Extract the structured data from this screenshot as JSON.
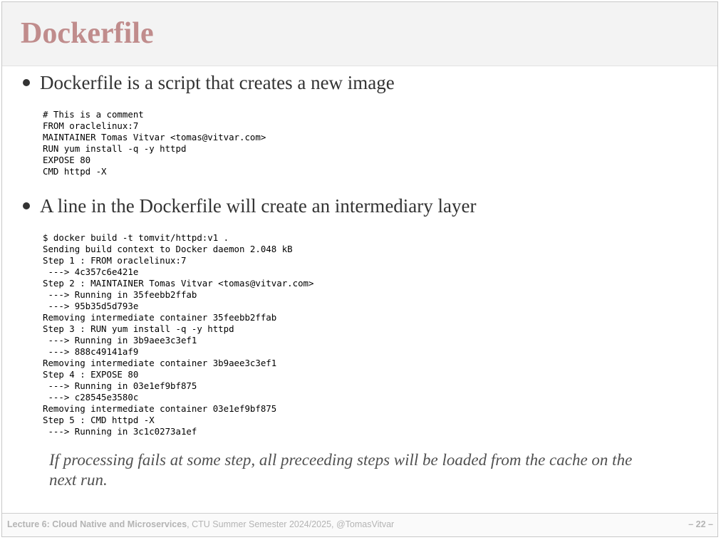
{
  "slide": {
    "title": "Dockerfile",
    "bullets": [
      {
        "text": "Dockerfile is a script that creates a new image",
        "code": "# This is a comment\nFROM oraclelinux:7\nMAINTAINER Tomas Vitvar <tomas@vitvar.com>\nRUN yum install -q -y httpd\nEXPOSE 80\nCMD httpd -X"
      },
      {
        "text": "A line in the Dockerfile will create an intermediary layer",
        "code": "$ docker build -t tomvit/httpd:v1 .\nSending build context to Docker daemon 2.048 kB\nStep 1 : FROM oraclelinux:7\n ---> 4c357c6e421e\nStep 2 : MAINTAINER Tomas Vitvar <tomas@vitvar.com>\n ---> Running in 35feebb2ffab\n ---> 95b35d5d793e\nRemoving intermediate container 35feebb2ffab\nStep 3 : RUN yum install -q -y httpd\n ---> Running in 3b9aee3c3ef1\n ---> 888c49141af9\nRemoving intermediate container 3b9aee3c3ef1\nStep 4 : EXPOSE 80\n ---> Running in 03e1ef9bf875\n ---> c28545e3580c\nRemoving intermediate container 03e1ef9bf875\nStep 5 : CMD httpd -X\n ---> Running in 3c1c0273a1ef"
      }
    ],
    "note": "If processing fails at some step, all preceeding steps will be loaded from the cache on the next run."
  },
  "footer": {
    "lecture": "Lecture 6: Cloud Native and Microservices",
    "course": ", CTU Summer Semester 2024/2025,  @TomasVitvar",
    "page": "– 22 –"
  }
}
